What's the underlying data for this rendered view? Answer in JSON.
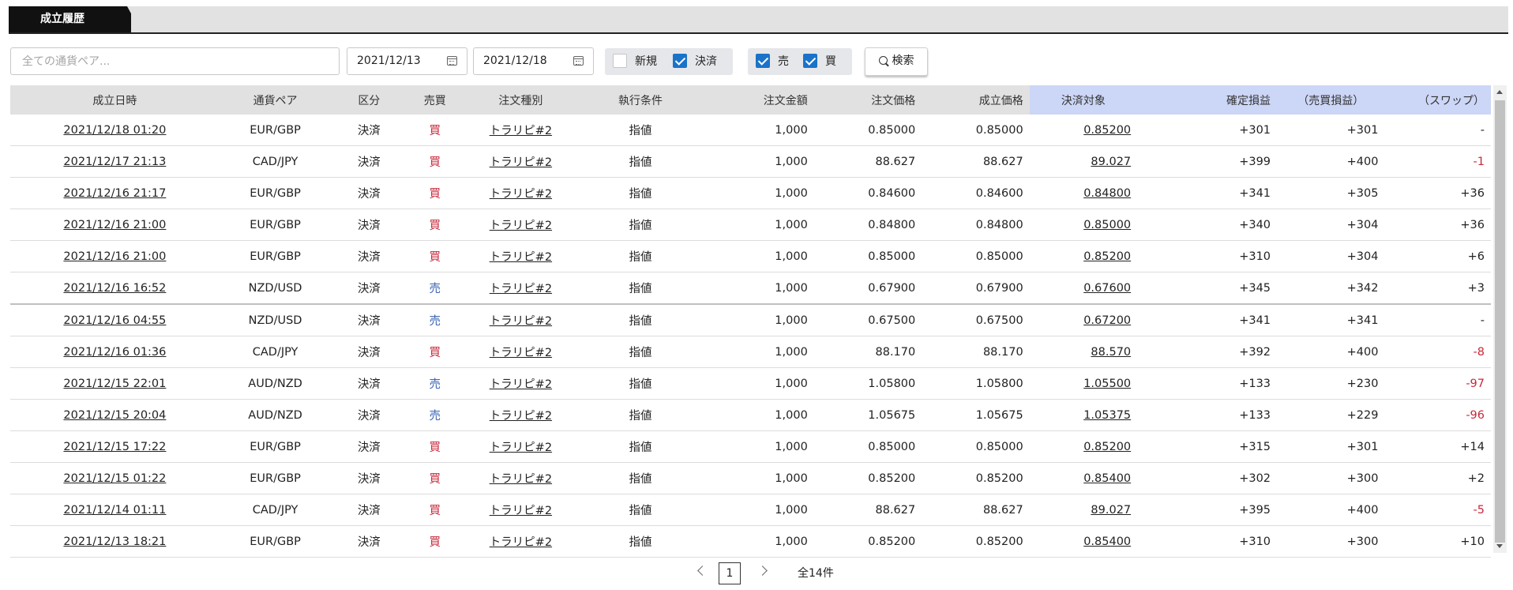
{
  "tabs": {
    "active_label": "成立履歴"
  },
  "filters": {
    "pair_placeholder": "全ての通貨ペア...",
    "date_from": "2021/12/13",
    "date_to": "2021/12/18",
    "kind_new_label": "新規",
    "kind_new_checked": false,
    "kind_close_label": "決済",
    "kind_close_checked": true,
    "side_sell_label": "売",
    "side_sell_checked": true,
    "side_buy_label": "買",
    "side_buy_checked": true,
    "search_label": "検索"
  },
  "columns": [
    "成立日時",
    "通貨ペア",
    "区分",
    "売買",
    "注文種別",
    "執行条件",
    "注文金額",
    "注文価格",
    "成立価格",
    "決済対象",
    "確定損益",
    "（売買損益）",
    "（スワップ）"
  ],
  "rows": [
    [
      "2021/12/18 01:20",
      "EUR/GBP",
      "決済",
      "買",
      "トラリピ#2",
      "指値",
      "1,000",
      "0.85000",
      "0.85000",
      "0.85200",
      "+301",
      "+301",
      "-"
    ],
    [
      "2021/12/17 21:13",
      "CAD/JPY",
      "決済",
      "買",
      "トラリピ#2",
      "指値",
      "1,000",
      "88.627",
      "88.627",
      "89.027",
      "+399",
      "+400",
      "-1"
    ],
    [
      "2021/12/16 21:17",
      "EUR/GBP",
      "決済",
      "買",
      "トラリピ#2",
      "指値",
      "1,000",
      "0.84600",
      "0.84600",
      "0.84800",
      "+341",
      "+305",
      "+36"
    ],
    [
      "2021/12/16 21:00",
      "EUR/GBP",
      "決済",
      "買",
      "トラリピ#2",
      "指値",
      "1,000",
      "0.84800",
      "0.84800",
      "0.85000",
      "+340",
      "+304",
      "+36"
    ],
    [
      "2021/12/16 21:00",
      "EUR/GBP",
      "決済",
      "買",
      "トラリピ#2",
      "指値",
      "1,000",
      "0.85000",
      "0.85000",
      "0.85200",
      "+310",
      "+304",
      "+6"
    ],
    [
      "2021/12/16 16:52",
      "NZD/USD",
      "決済",
      "売",
      "トラリピ#2",
      "指値",
      "1,000",
      "0.67900",
      "0.67900",
      "0.67600",
      "+345",
      "+342",
      "+3"
    ],
    [
      "2021/12/16 04:55",
      "NZD/USD",
      "決済",
      "売",
      "トラリピ#2",
      "指値",
      "1,000",
      "0.67500",
      "0.67500",
      "0.67200",
      "+341",
      "+341",
      "-"
    ],
    [
      "2021/12/16 01:36",
      "CAD/JPY",
      "決済",
      "買",
      "トラリピ#2",
      "指値",
      "1,000",
      "88.170",
      "88.170",
      "88.570",
      "+392",
      "+400",
      "-8"
    ],
    [
      "2021/12/15 22:01",
      "AUD/NZD",
      "決済",
      "売",
      "トラリピ#2",
      "指値",
      "1,000",
      "1.05800",
      "1.05800",
      "1.05500",
      "+133",
      "+230",
      "-97"
    ],
    [
      "2021/12/15 20:04",
      "AUD/NZD",
      "決済",
      "売",
      "トラリピ#2",
      "指値",
      "1,000",
      "1.05675",
      "1.05675",
      "1.05375",
      "+133",
      "+229",
      "-96"
    ],
    [
      "2021/12/15 17:22",
      "EUR/GBP",
      "決済",
      "買",
      "トラリピ#2",
      "指値",
      "1,000",
      "0.85000",
      "0.85000",
      "0.85200",
      "+315",
      "+301",
      "+14"
    ],
    [
      "2021/12/15 01:22",
      "EUR/GBP",
      "決済",
      "買",
      "トラリピ#2",
      "指値",
      "1,000",
      "0.85200",
      "0.85200",
      "0.85400",
      "+302",
      "+300",
      "+2"
    ],
    [
      "2021/12/14 01:11",
      "CAD/JPY",
      "決済",
      "買",
      "トラリピ#2",
      "指値",
      "1,000",
      "88.627",
      "88.627",
      "89.027",
      "+395",
      "+400",
      "-5"
    ],
    [
      "2021/12/13 18:21",
      "EUR/GBP",
      "決済",
      "買",
      "トラリピ#2",
      "指値",
      "1,000",
      "0.85200",
      "0.85200",
      "0.85400",
      "+310",
      "+300",
      "+10"
    ]
  ],
  "pagination": {
    "current_page": "1",
    "total_label": "全14件"
  },
  "colors": {
    "buy": "#c8283a",
    "sell": "#3a64b4",
    "negative": "#c8283a",
    "highlight_header": "#ccd6f6",
    "checkbox": "#1a73c9"
  }
}
